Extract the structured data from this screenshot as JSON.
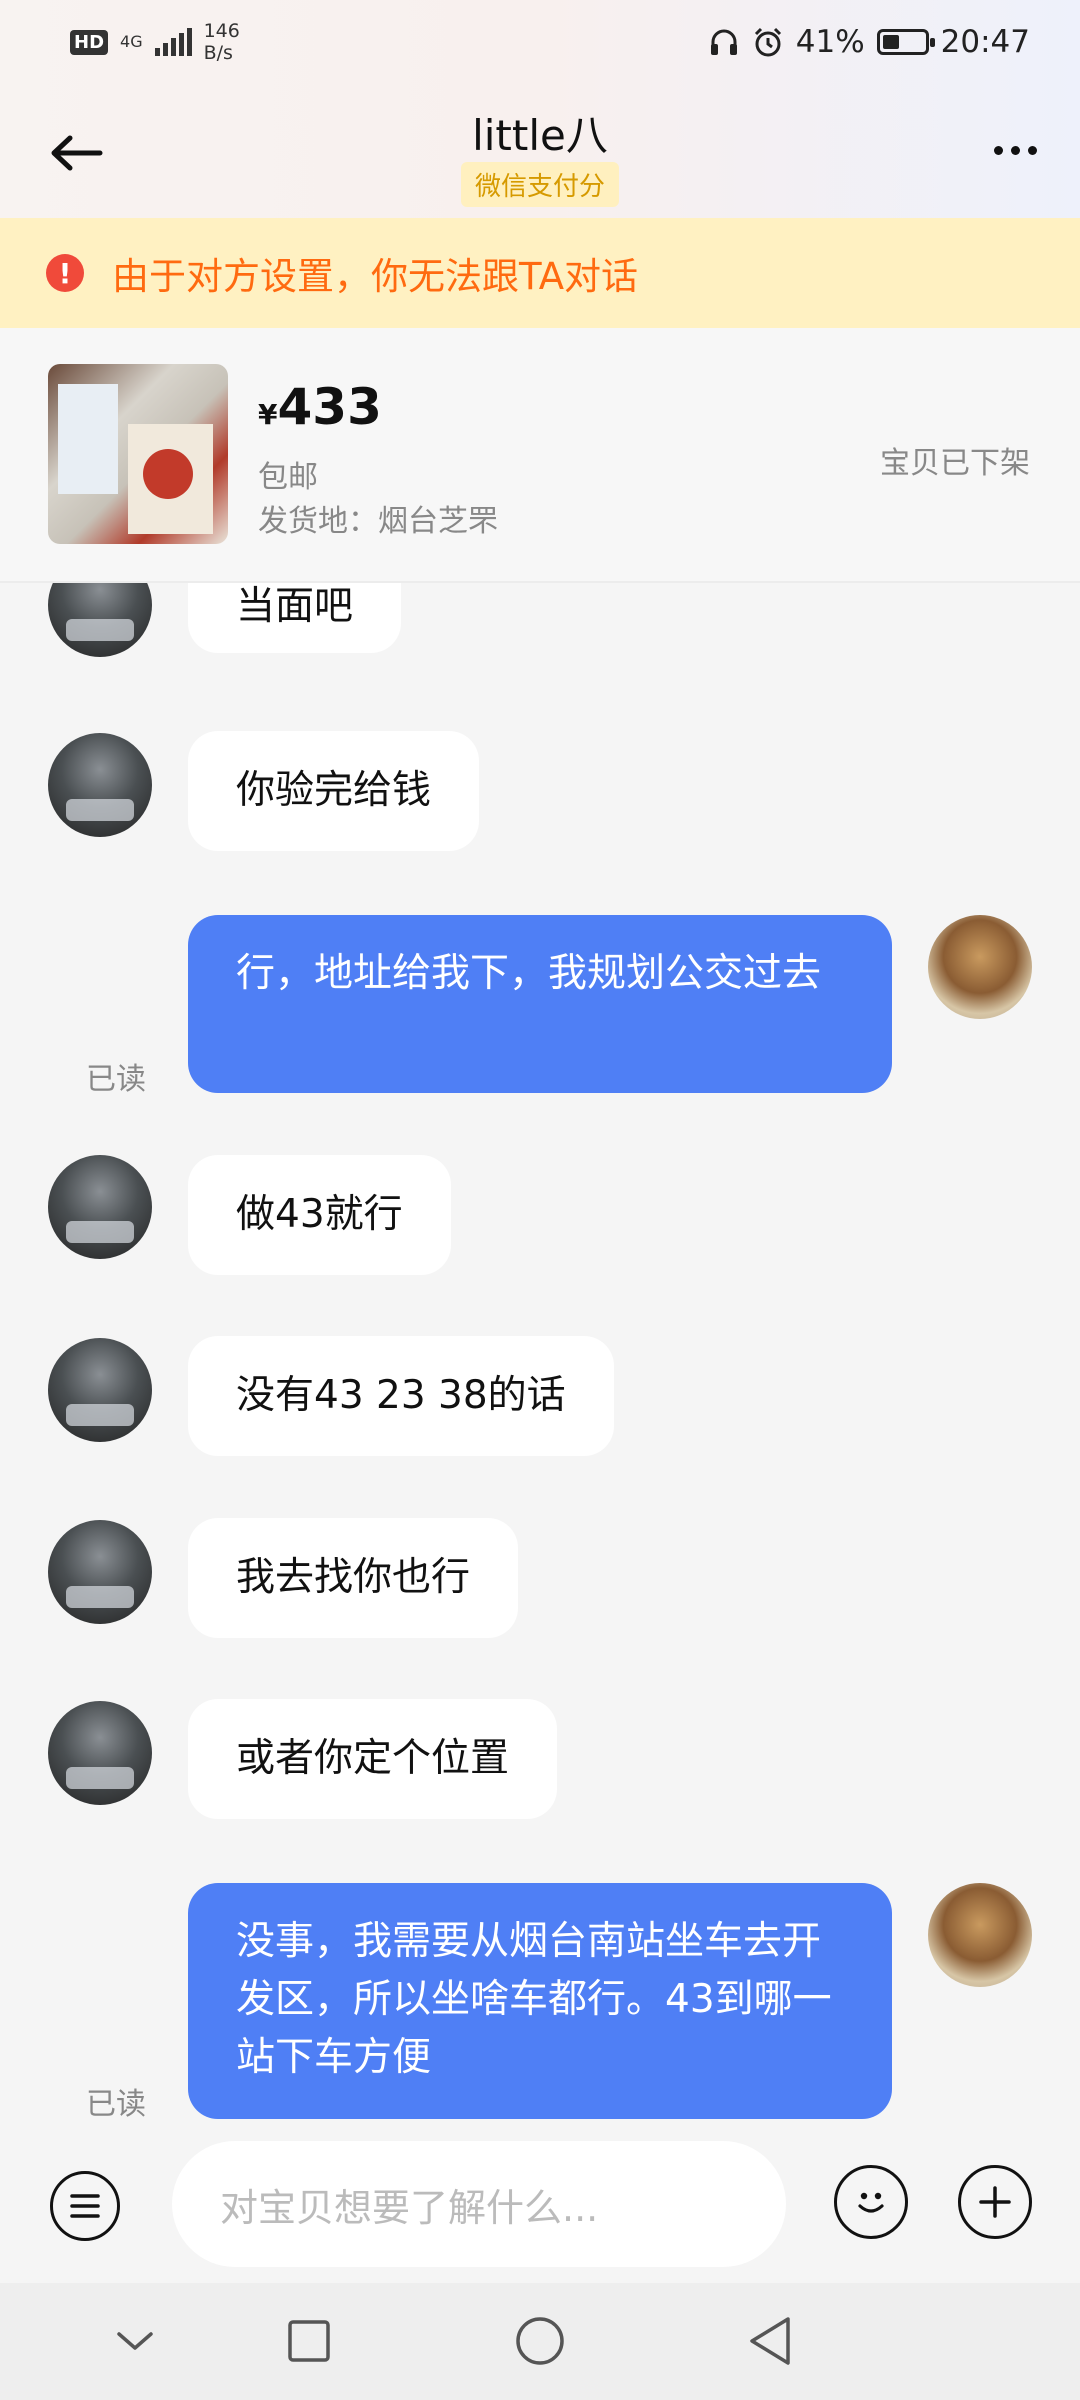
{
  "status_bar": {
    "hd": "HD",
    "net_type": "4G",
    "net_speed_value": "146",
    "net_speed_unit": "B/s",
    "battery": "41%",
    "battery_level": 0.41,
    "time": "20:47"
  },
  "header": {
    "title": "little八",
    "badge": "微信支付分"
  },
  "warning": {
    "icon": "!",
    "text": "由于对方设置，你无法跟TA对话"
  },
  "product": {
    "currency": "¥",
    "price": "433",
    "shipping": "包邮",
    "origin": "发货地：烟台芝罘",
    "status": "宝贝已下架"
  },
  "messages": [
    {
      "from": "other",
      "text": "当面吧"
    },
    {
      "from": "other",
      "text": "你验完给钱"
    },
    {
      "from": "me",
      "text": "行，地址给我下，我规划公交过去",
      "read": "已读"
    },
    {
      "from": "other",
      "text": "做43就行"
    },
    {
      "from": "other",
      "text": "没有43 23 38的话"
    },
    {
      "from": "other",
      "text": "我去找你也行"
    },
    {
      "from": "other",
      "text": "或者你定个位置"
    },
    {
      "from": "me",
      "text": "没事，我需要从烟台南站坐车去开发区，所以坐啥车都行。43到哪一站下车方便",
      "read": "已读"
    }
  ],
  "input": {
    "placeholder": "对宝贝想要了解什么..."
  },
  "colors": {
    "accent_blue": "#4f7ff5",
    "warning_bg": "#fff1c2",
    "warning_text": "#ff6a10",
    "badge_text": "#d69a00"
  }
}
